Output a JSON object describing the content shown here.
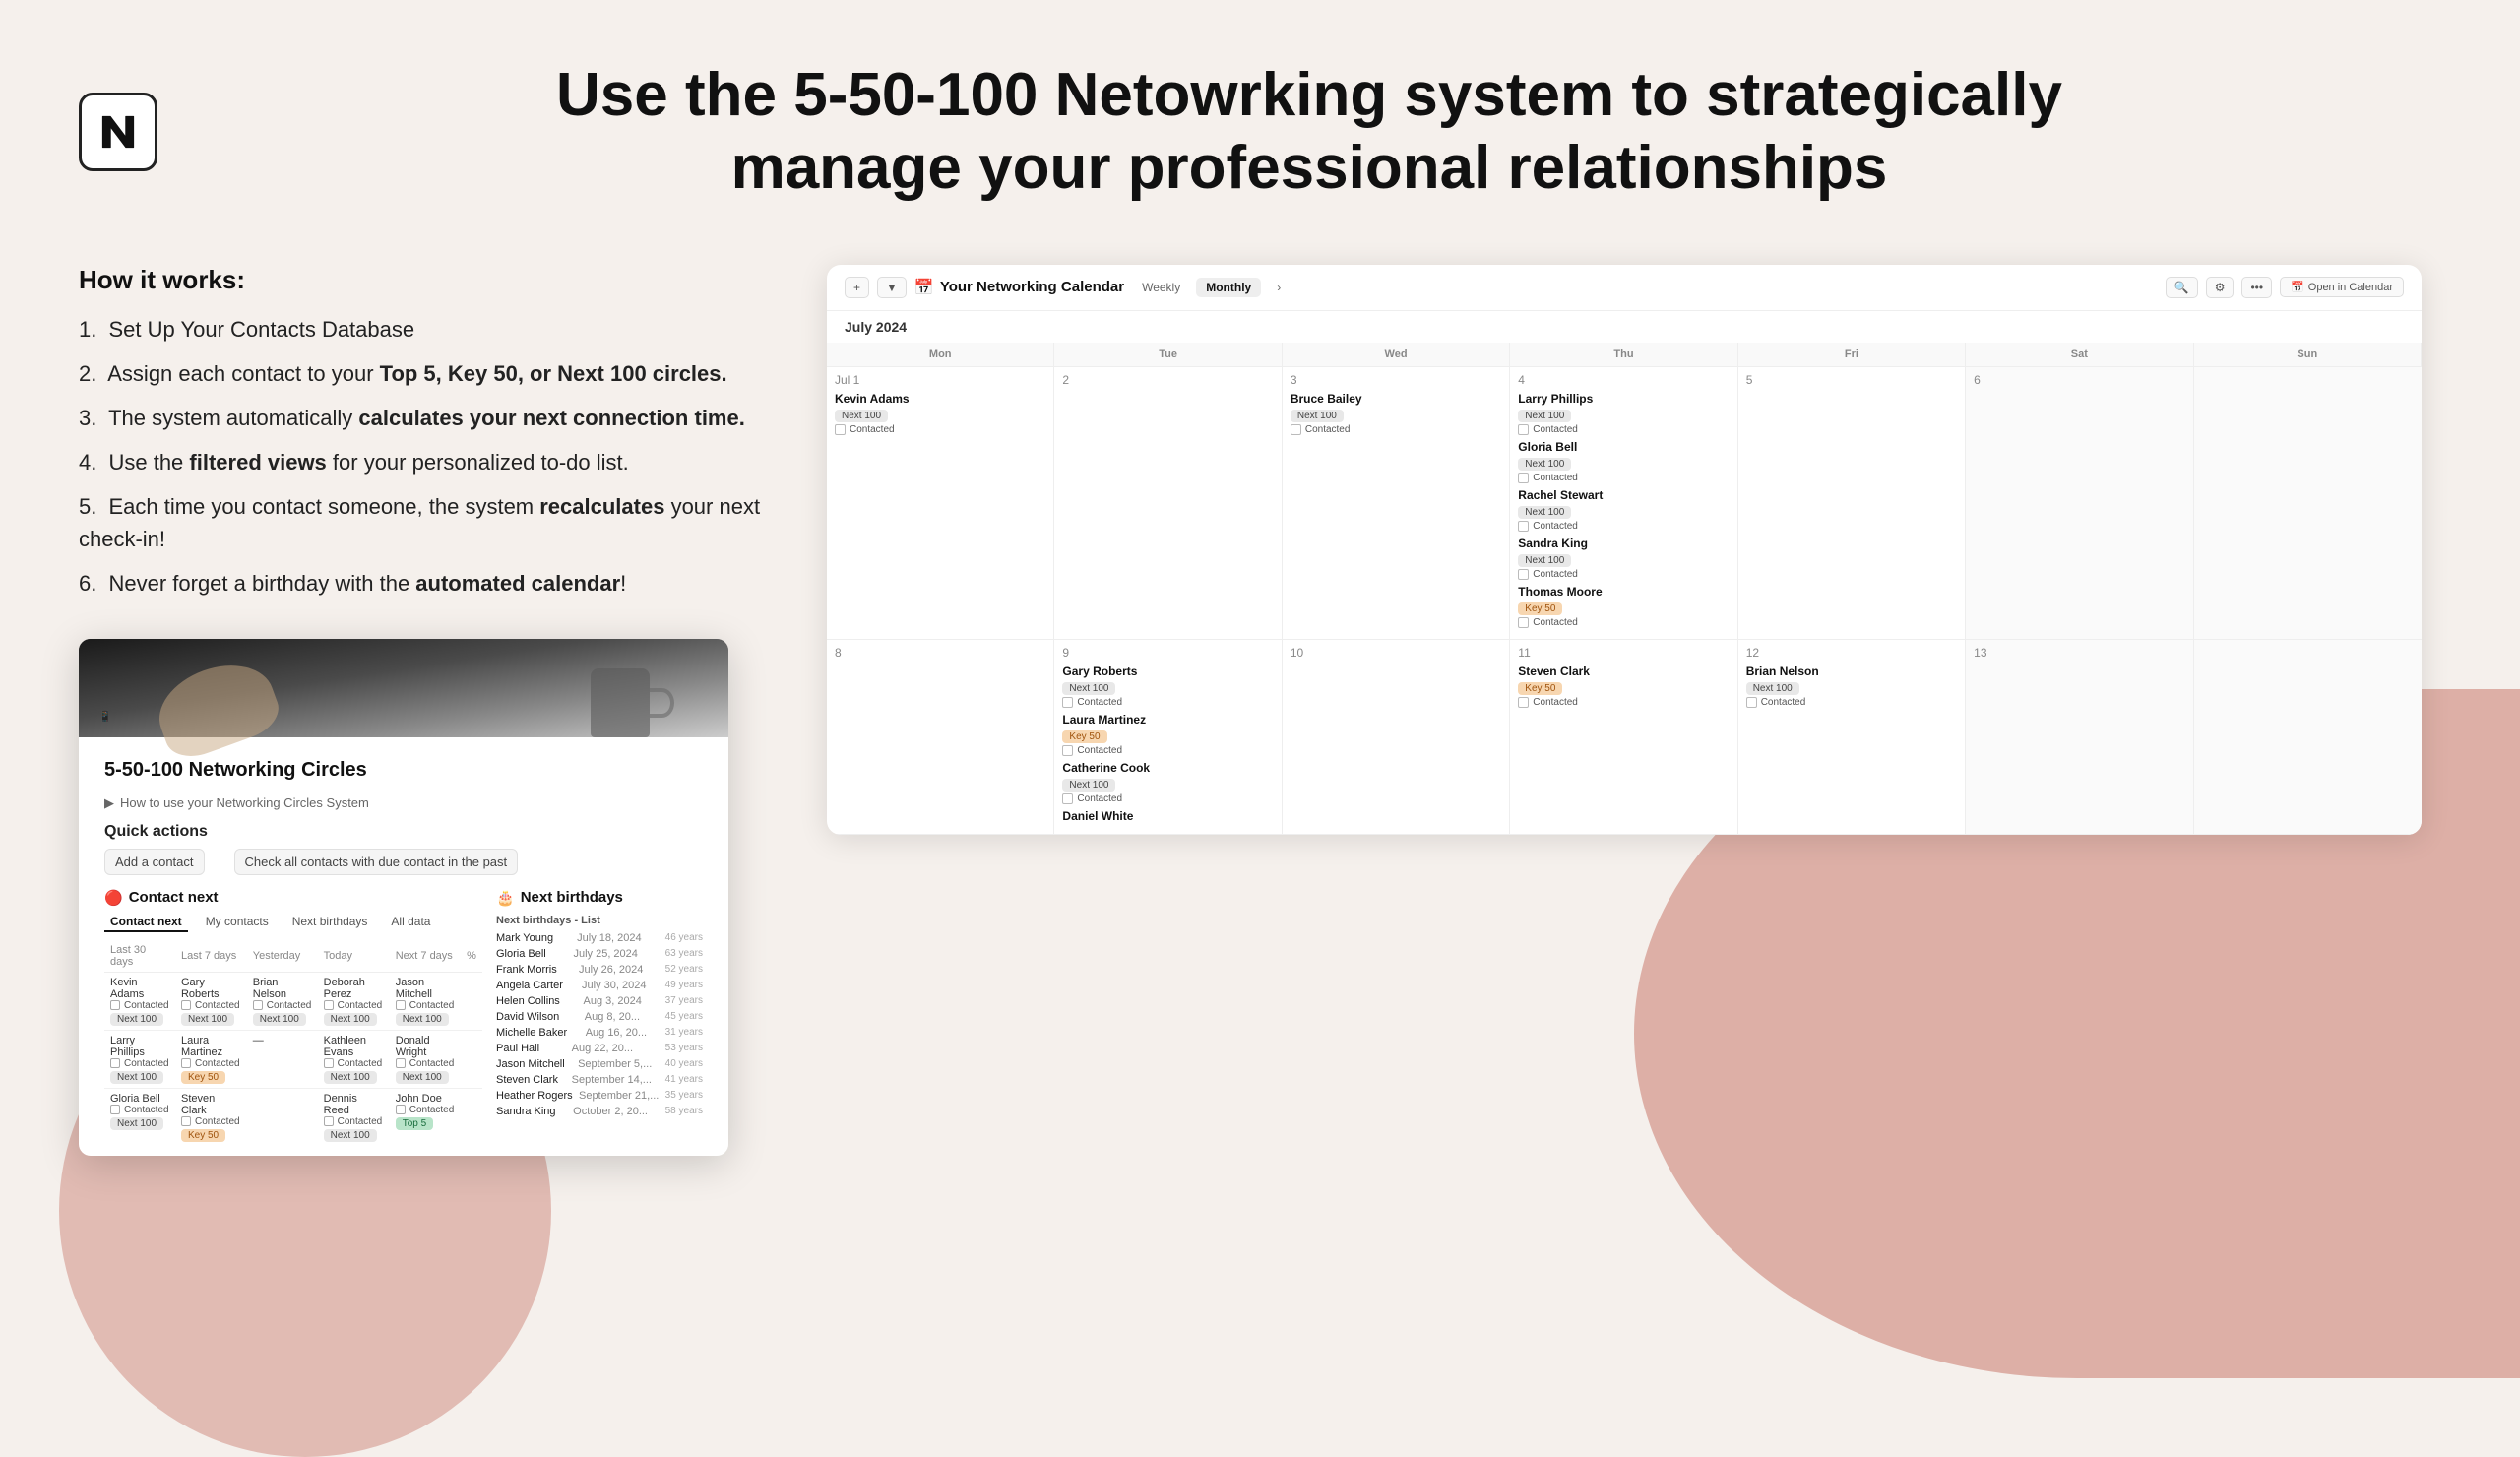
{
  "header": {
    "title_line1": "Use the 5-50-100 Netowrking system to strategically",
    "title_line2": "manage your professional relationships"
  },
  "how_it_works": {
    "title": "How it works:",
    "steps": [
      {
        "num": "1.",
        "text": "Set Up Your Contacts Database"
      },
      {
        "num": "2.",
        "text": "Assign each contact to your Top 5, Key 50, or Next 100 circles."
      },
      {
        "num": "3.",
        "text": "The system automatically calculates your next connection time."
      },
      {
        "num": "4.",
        "text": "Use the filtered views for your personalized to-do list."
      },
      {
        "num": "5.",
        "text": "Each time you contact someone, the system recalculates your next check-in!"
      },
      {
        "num": "6.",
        "text": "Never forget a birthday with the automated calendar!"
      }
    ]
  },
  "notion_screen": {
    "title": "5-50-100 Networking Circles",
    "breadcrumb": "How to use your Networking Circles System",
    "quick_actions_title": "Quick actions",
    "quick_action_1": "Add a contact",
    "quick_action_2": "Check all contacts with due contact in the past",
    "contact_next_title": "Contact next",
    "next_birthdays_title": "Next birthdays",
    "tabs": [
      "Contact next",
      "My contacts",
      "Next birthdays",
      "All data"
    ],
    "column_headers": [
      "Last 30 days",
      "Last 7 days",
      "Yesterday",
      "Today",
      "Next 7 days",
      "%"
    ],
    "table_rows": [
      {
        "name": "Kevin Adams",
        "tag": "Next 100",
        "checked": false,
        "col1_name": "Gary Roberts",
        "col1_tag": "Next 100",
        "col1_checked": false,
        "col2_name": "Brian Nelson",
        "col2_tag": "Next 100",
        "col2_checked": false,
        "col3_name": "Deborah Perez",
        "col3_tag": "Next 100",
        "col3_checked": false,
        "col4_name": "Jason Mitchell",
        "col4_tag": "Next 100",
        "col4_checked": false
      },
      {
        "name": "Larry Phillips",
        "tag": "Next 100",
        "checked": false,
        "col1_name": "Laura Martinez",
        "col1_tag": "Key 50",
        "col1_checked": false,
        "col2_name": "",
        "col2_tag": "",
        "col2_checked": false,
        "col3_name": "Kathleen Evans",
        "col3_tag": "Next 100",
        "col3_checked": false,
        "col4_name": "Donald Wright",
        "col4_tag": "Next 100",
        "col4_checked": false
      },
      {
        "name": "Gloria Bell",
        "tag": "Next 100",
        "checked": false,
        "col1_name": "Steven Clark",
        "col1_tag": "Key 50",
        "col1_checked": false,
        "col2_name": "",
        "col2_tag": "",
        "col2_checked": false,
        "col3_name": "Dennis Reed",
        "col3_tag": "Next 100",
        "col3_checked": false,
        "col4_name": "John Doe",
        "col4_tag": "Top 5",
        "col4_checked": false
      }
    ],
    "birthdays_list": [
      {
        "name": "Mark Young",
        "date": "July 18, 2024",
        "age": "46 years"
      },
      {
        "name": "Gloria Bell",
        "date": "July 25, 2024",
        "age": "63 years"
      },
      {
        "name": "Frank Morris",
        "date": "July 26, 2024",
        "age": "52 years"
      },
      {
        "name": "Angela Carter",
        "date": "July 30, 2024",
        "age": "49 years"
      },
      {
        "name": "Helen Collins",
        "date": "August 3, 2024",
        "age": "37 years"
      },
      {
        "name": "David Wilson",
        "date": "August 8-20...",
        "age": "45 years"
      },
      {
        "name": "Michelle Baker",
        "date": "August 16, 20...",
        "age": "31 years"
      },
      {
        "name": "Paul Hall",
        "date": "August 22, 20...",
        "age": "53 years"
      },
      {
        "name": "Jason Mitchell",
        "date": "September 5,...",
        "age": "40 years"
      },
      {
        "name": "Steven Clark",
        "date": "September 14,...",
        "age": "41 years"
      },
      {
        "name": "Heather Rogers",
        "date": "September 21,...",
        "age": "35 years"
      },
      {
        "name": "Sandra King",
        "date": "October 2, 20...",
        "age": "58 years"
      }
    ]
  },
  "calendar": {
    "title": "Your Networking Calendar",
    "month": "July 2024",
    "views": [
      "Weekly",
      "Monthly"
    ],
    "active_view": "Monthly",
    "open_btn": "Open in Calendar",
    "days": [
      "Mon",
      "Tue",
      "Wed",
      "Thu",
      "Fri",
      "Sat",
      "Sun"
    ],
    "week1": [
      {
        "day": "Jul 1",
        "events": [
          {
            "name": "Kevin Adams",
            "tag": "Next 100",
            "tag_type": "next100"
          }
        ]
      },
      {
        "day": "2",
        "events": []
      },
      {
        "day": "3",
        "events": [
          {
            "name": "Bruce Bailey",
            "tag": "Next 100",
            "tag_type": "next100"
          }
        ]
      },
      {
        "day": "4",
        "events": [
          {
            "name": "Larry Phillips",
            "tag": "Next 100",
            "tag_type": "next100"
          },
          {
            "name": "Gloria Bell",
            "tag": "Next 100",
            "tag_type": "next100"
          },
          {
            "name": "Rachel Stewart",
            "tag": "Next 100",
            "tag_type": "next100"
          },
          {
            "name": "Sandra King",
            "tag": "Next 100",
            "tag_type": "next100"
          },
          {
            "name": "Thomas Moore",
            "tag": "Key 50",
            "tag_type": "key50"
          }
        ]
      },
      {
        "day": "5",
        "events": []
      },
      {
        "day": "6",
        "events": []
      },
      {
        "day": "",
        "events": []
      }
    ],
    "week2": [
      {
        "day": "8",
        "events": []
      },
      {
        "day": "9",
        "events": [
          {
            "name": "Gary Roberts",
            "tag": "Next 100",
            "tag_type": "next100"
          },
          {
            "name": "Laura Martinez",
            "tag": "Key 50",
            "tag_type": "key50"
          },
          {
            "name": "Catherine Cook",
            "tag": "Next 100",
            "tag_type": "next100"
          },
          {
            "name": "Daniel White",
            "tag": "",
            "tag_type": ""
          }
        ]
      },
      {
        "day": "10",
        "events": []
      },
      {
        "day": "11",
        "events": [
          {
            "name": "Steven Clark",
            "tag": "Key 50",
            "tag_type": "key50"
          }
        ]
      },
      {
        "day": "12",
        "events": [
          {
            "name": "Brian Nelson",
            "tag": "Next 100",
            "tag_type": "next100"
          }
        ]
      },
      {
        "day": "13",
        "events": []
      },
      {
        "day": "",
        "events": []
      }
    ]
  }
}
